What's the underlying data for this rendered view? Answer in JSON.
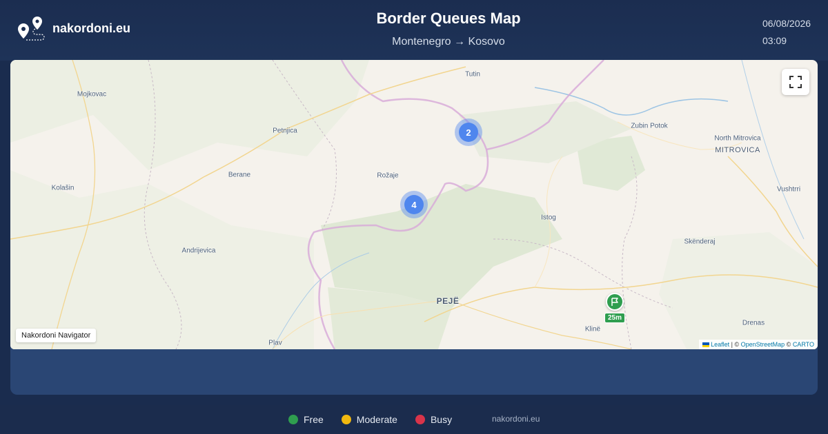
{
  "header": {
    "brand": "nakordoni.eu",
    "title": "Border Queues Map",
    "route": "Montenegro → Kosovo",
    "date": "06/08/2026",
    "time": "03:09"
  },
  "map": {
    "places": [
      {
        "id": "tutin",
        "name": "Tutin"
      },
      {
        "id": "mojkovac",
        "name": "Mojkovac"
      },
      {
        "id": "petnjica",
        "name": "Petnjica"
      },
      {
        "id": "zubin-potok",
        "name": "Zubin Potok"
      },
      {
        "id": "north-mitrovica",
        "name": "North Mitrovica"
      },
      {
        "id": "mitrovica",
        "name": "MITROVICA"
      },
      {
        "id": "berane",
        "name": "Berane"
      },
      {
        "id": "rozaje",
        "name": "Rožaje"
      },
      {
        "id": "kolasin",
        "name": "Kolašin"
      },
      {
        "id": "vushtrri",
        "name": "Vushtrri"
      },
      {
        "id": "istog",
        "name": "Istog"
      },
      {
        "id": "skenderaj",
        "name": "Skënderaj"
      },
      {
        "id": "andrijevica",
        "name": "Andrijevica"
      },
      {
        "id": "peje",
        "name": "PEJË"
      },
      {
        "id": "drenas",
        "name": "Drenas"
      },
      {
        "id": "kline",
        "name": "Klinë"
      },
      {
        "id": "plav",
        "name": "Plav"
      }
    ],
    "clusters": [
      {
        "count": "2"
      },
      {
        "count": "4"
      }
    ],
    "crossing_marker": {
      "icon": "flag-icon",
      "status": "free",
      "wait": "25m",
      "color": "#2f9e4f"
    },
    "navigator_label": "Nakordoni Navigator",
    "attribution": {
      "leaflet": "Leaflet",
      "osm": "OpenStreetMap",
      "carto": "CARTO",
      "sep1": " | © ",
      "sep2": " © "
    }
  },
  "legend": [
    {
      "label": "Free",
      "color": "#2f9e4f"
    },
    {
      "label": "Moderate",
      "color": "#f2b90f"
    },
    {
      "label": "Busy",
      "color": "#d9344a"
    }
  ],
  "footer": {
    "site": "nakordoni.eu"
  }
}
